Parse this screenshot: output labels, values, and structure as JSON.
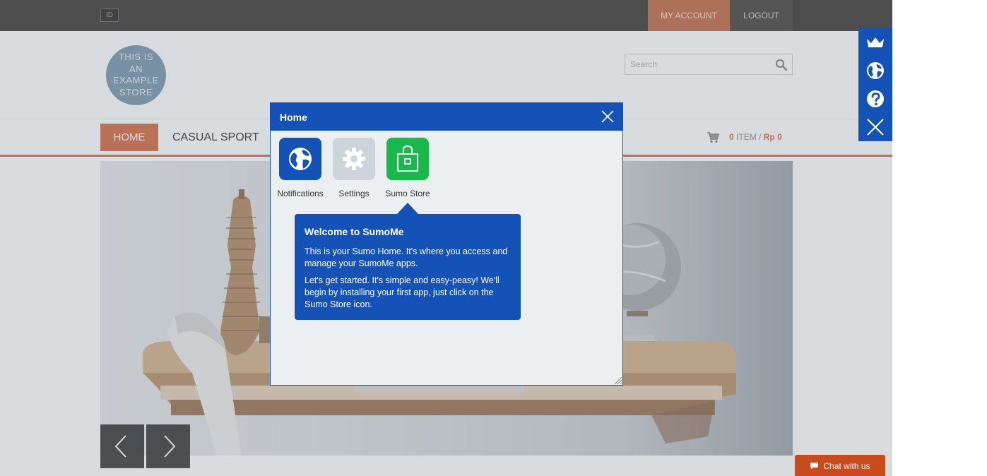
{
  "topbar": {
    "lang": "ID",
    "my_account": "MY ACCOUNT",
    "logout": "LOGOUT"
  },
  "header": {
    "logo_lines": [
      "THIS IS",
      "AN",
      "EXAMPLE",
      "STORE"
    ],
    "search_placeholder": "Search"
  },
  "nav": {
    "items": [
      {
        "label": "HOME",
        "active": true
      },
      {
        "label": "CASUAL SPORT",
        "active": false
      }
    ],
    "cart": {
      "count": "0",
      "item_label": "ITEM",
      "separator": "/",
      "currency": "Rp",
      "amount": "0"
    }
  },
  "sumo_sidebar": {
    "icons": [
      "crown-icon",
      "globe-icon",
      "help-icon",
      "close-icon"
    ]
  },
  "modal": {
    "title": "Home",
    "apps": [
      {
        "label": "Notifications",
        "icon": "globe-icon",
        "color": "#1452b8"
      },
      {
        "label": "Settings",
        "icon": "gear-icon",
        "color": "#cdd5db"
      },
      {
        "label": "Sumo Store",
        "icon": "shopping-bag-icon",
        "color": "#19b84b"
      }
    ],
    "tooltip": {
      "title": "Welcome to SumoMe",
      "p1": "This is your Sumo Home. It's where you access and manage your SumoMe apps.",
      "p2": "Let's get started. It's simple and easy-peasy! We'll begin by installing your first app, just click on the Sumo Store icon."
    }
  },
  "chat": {
    "label": "Chat with us"
  },
  "colors": {
    "accent": "#d46b45",
    "sumo_blue": "#1452b8",
    "topbar": "#3f3a37",
    "chat": "#c84a1d"
  }
}
